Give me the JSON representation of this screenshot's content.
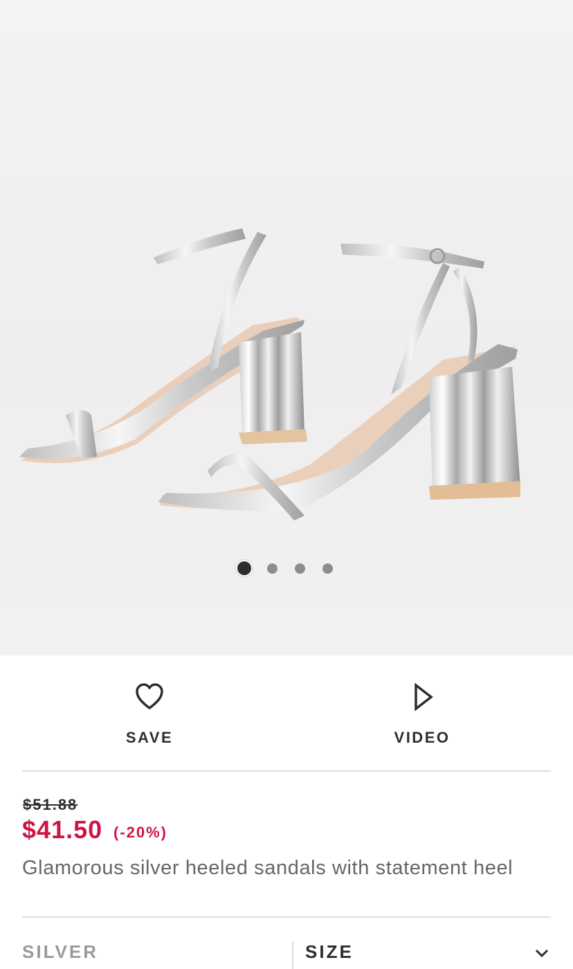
{
  "gallery": {
    "image_alt": "Silver heeled sandals with fluted statement heel",
    "page_count": 4,
    "active_index": 0
  },
  "actions": {
    "save_label": "SAVE",
    "save_icon": "heart-icon",
    "video_label": "VIDEO",
    "video_icon": "play-icon"
  },
  "price": {
    "original": "$51.88",
    "current": "$41.50",
    "discount": "(-20%)",
    "sale_color": "#d01345"
  },
  "product": {
    "description": "Glamorous silver heeled sandals with statement heel"
  },
  "selectors": {
    "colour_value": "SILVER",
    "size_label": "SIZE",
    "size_icon": "chevron-down-icon"
  }
}
